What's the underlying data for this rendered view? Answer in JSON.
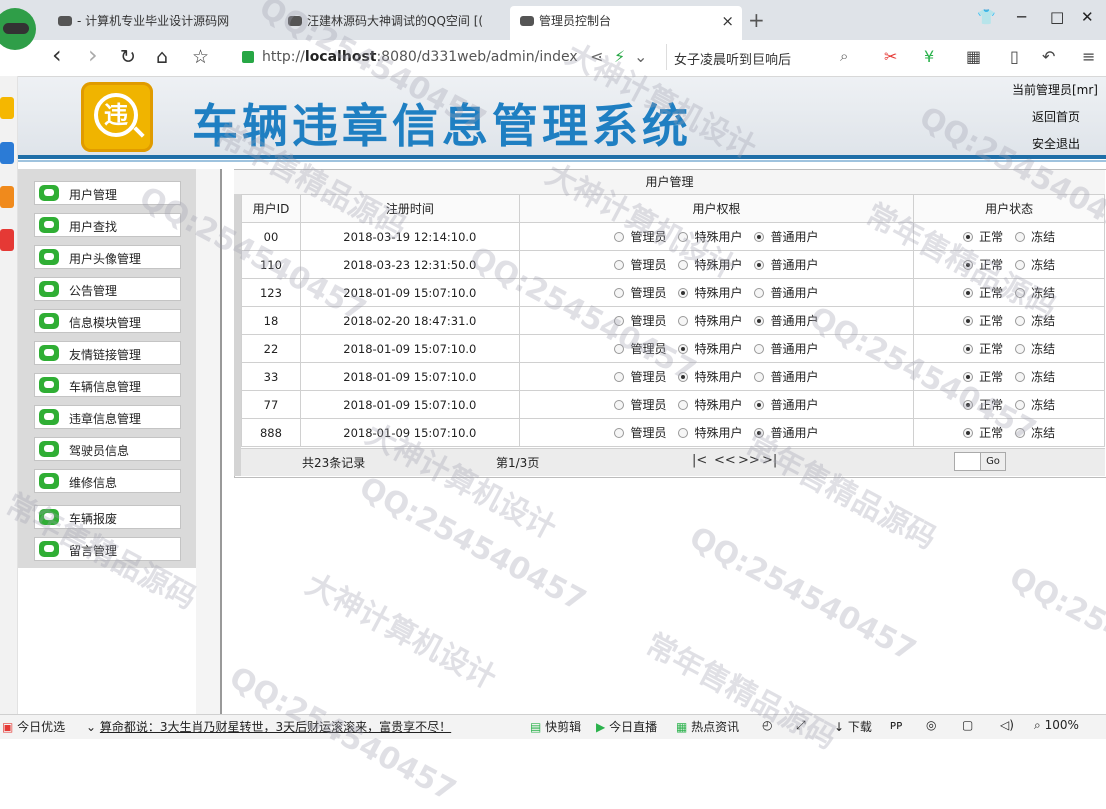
{
  "browser": {
    "tabs": [
      {
        "label": "- 计算机专业毕业设计源码网"
      },
      {
        "label": "汪建林源码大神调试的QQ空间 [("
      },
      {
        "label": "管理员控制台",
        "close": "×"
      }
    ],
    "new_tab": "+",
    "window_controls": {
      "minimize": "─",
      "maximize": "□",
      "close": "✕",
      "skin": "👕"
    },
    "nav": {
      "back": "‹",
      "forward": "›",
      "refresh": "↻",
      "home": "⌂",
      "favorite": "☆"
    },
    "url": {
      "prefix": "http://",
      "host": "localhost",
      "rest": ":8080/d331web/admin/index"
    },
    "search_text": "女子凌晨听到巨响后",
    "toolbar_icons": [
      "share-icon",
      "bolt-icon",
      "chevron-down-icon",
      "search-icon",
      "scissors-icon",
      "money-icon",
      "apps-icon",
      "phone-icon",
      "undo-icon",
      "menu-icon"
    ]
  },
  "header": {
    "logo_char": "违",
    "title": "车辆违章信息管理系统",
    "admin_label": "当前管理员[mr]",
    "home_link": "返回首页",
    "logout_link": "安全退出"
  },
  "menu": {
    "items": [
      {
        "label": "用户管理"
      },
      {
        "label": "用户查找"
      },
      {
        "label": "用户头像管理"
      },
      {
        "label": "公告管理"
      },
      {
        "label": "信息模块管理"
      },
      {
        "label": "友情链接管理"
      },
      {
        "label": "车辆信息管理"
      },
      {
        "label": "违章信息管理"
      },
      {
        "label": "驾驶员信息"
      },
      {
        "label": "维修信息"
      },
      {
        "label": "车辆报废"
      },
      {
        "label": "留言管理"
      }
    ]
  },
  "table": {
    "title": "用户管理",
    "headers": {
      "id": "用户ID",
      "time": "注册时间",
      "perm": "用户权根",
      "status": "用户状态"
    },
    "perm_options": [
      "管理员",
      "特殊用户",
      "普通用户"
    ],
    "status_options": [
      "正常",
      "冻结"
    ],
    "rows": [
      {
        "id": "00",
        "time": "2018-03-19 12:14:10.0",
        "perm": 2,
        "status": 0
      },
      {
        "id": "110",
        "time": "2018-03-23 12:31:50.0",
        "perm": 2,
        "status": 0
      },
      {
        "id": "123",
        "time": "2018-01-09 15:07:10.0",
        "perm": 1,
        "status": 0
      },
      {
        "id": "18",
        "time": "2018-02-20 18:47:31.0",
        "perm": 2,
        "status": 0
      },
      {
        "id": "22",
        "time": "2018-01-09 15:07:10.0",
        "perm": 1,
        "status": 0
      },
      {
        "id": "33",
        "time": "2018-01-09 15:07:10.0",
        "perm": 1,
        "status": 0
      },
      {
        "id": "77",
        "time": "2018-01-09 15:07:10.0",
        "perm": 2,
        "status": 0
      },
      {
        "id": "888",
        "time": "2018-01-09 15:07:10.0",
        "perm": 2,
        "status": 0
      }
    ],
    "pager": {
      "total": "共23条记录",
      "page": "第1/3页",
      "first": "|<",
      "prev": "<<",
      "next": ">>",
      "last": ">|",
      "go": "Go"
    }
  },
  "statusbar": {
    "deal": "今日优选",
    "news": "算命都说：3大生肖乃财星转世，3天后财运滚滚来，富贵享不尽！",
    "clip": "快剪辑",
    "live": "今日直播",
    "hot": "热点资讯",
    "download": "下载",
    "zoom": "100%"
  },
  "watermarks": [
    "QQ:254540457",
    "大神计算机设计",
    "常年售精品源码"
  ]
}
